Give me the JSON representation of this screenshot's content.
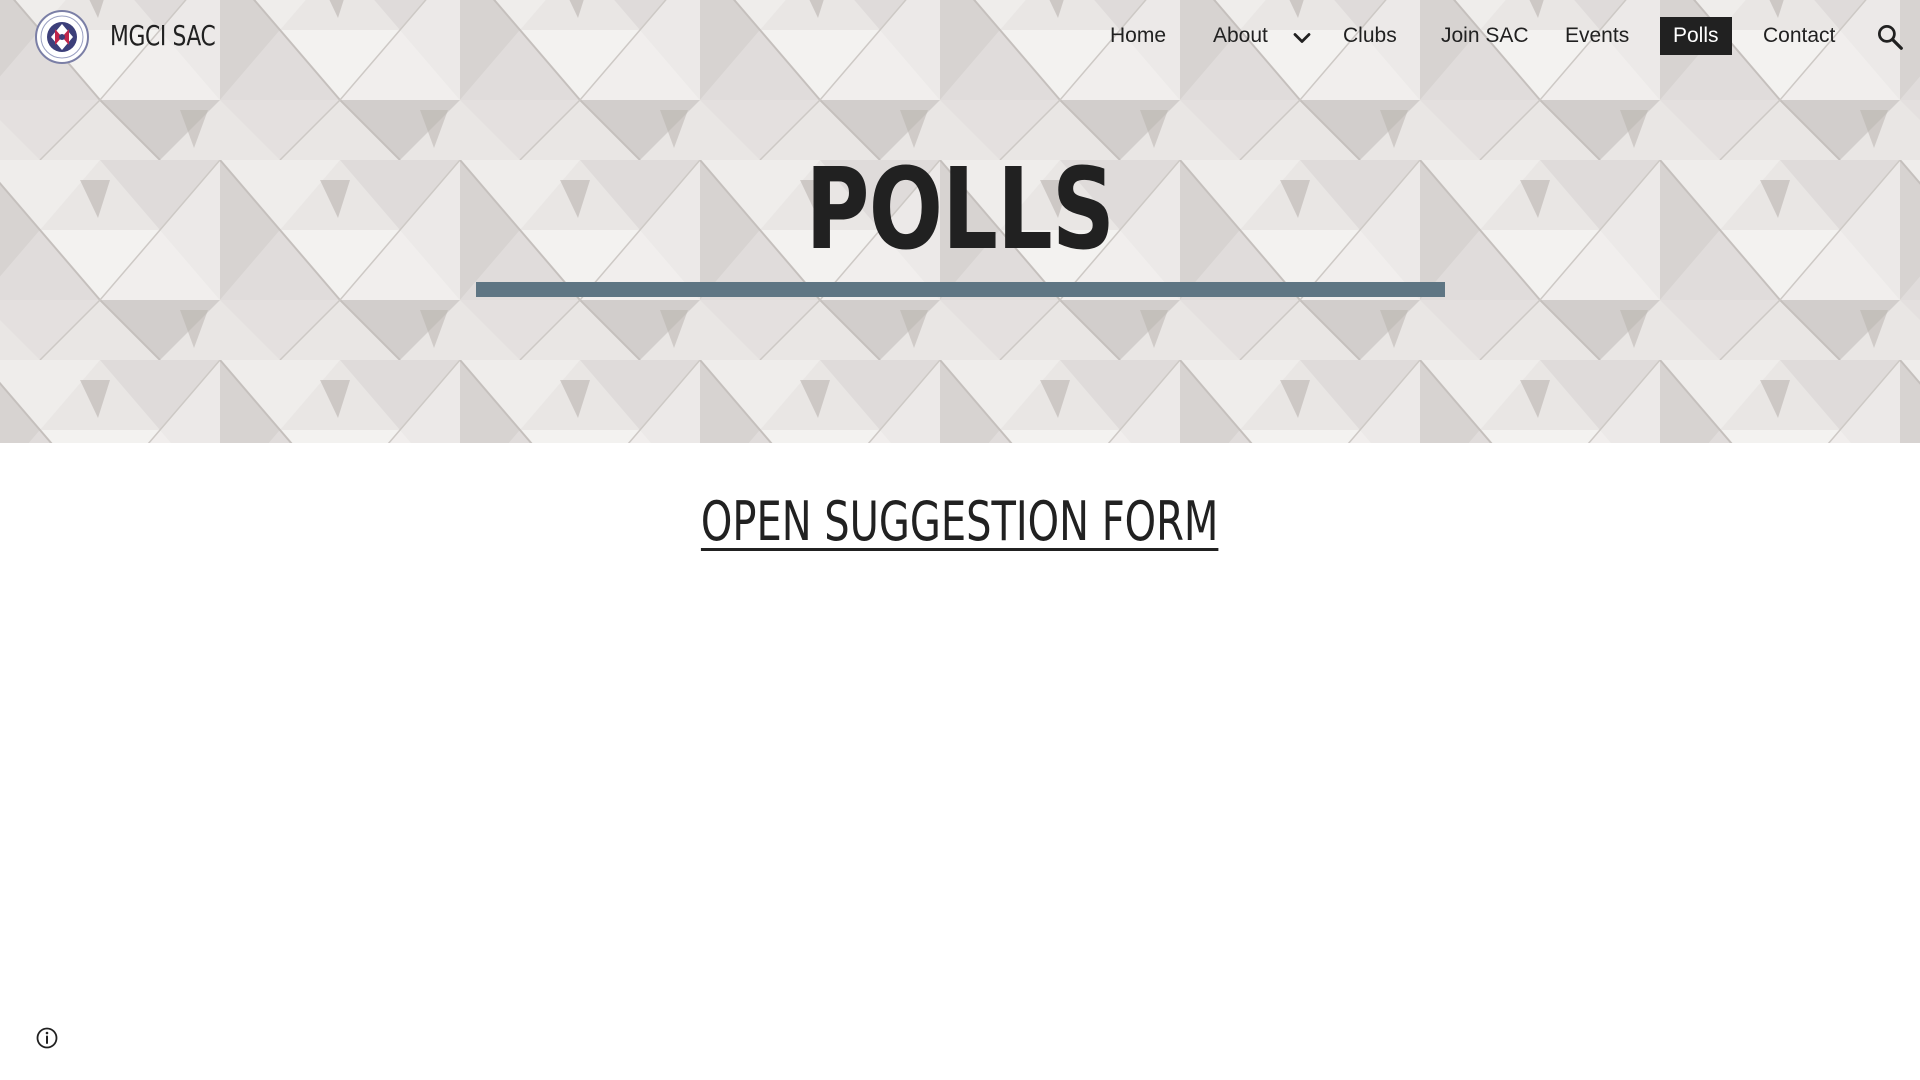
{
  "site": {
    "title": "MGCI SAC"
  },
  "nav": {
    "items": [
      {
        "label": "Home",
        "active": false
      },
      {
        "label": "About",
        "active": false
      },
      {
        "label": "Clubs",
        "active": false
      },
      {
        "label": "Join SAC",
        "active": false
      },
      {
        "label": "Events",
        "active": false
      },
      {
        "label": "Polls",
        "active": true
      },
      {
        "label": "Contact",
        "active": false
      }
    ],
    "icons": {
      "about_dropdown": "chevron-down-icon",
      "search": "search-icon"
    }
  },
  "hero": {
    "title": "POLLS",
    "rule_color": "#5e7583"
  },
  "main": {
    "link_text": "OPEN SUGGESTION FORM"
  },
  "footer": {
    "info_icon": "info-icon"
  }
}
